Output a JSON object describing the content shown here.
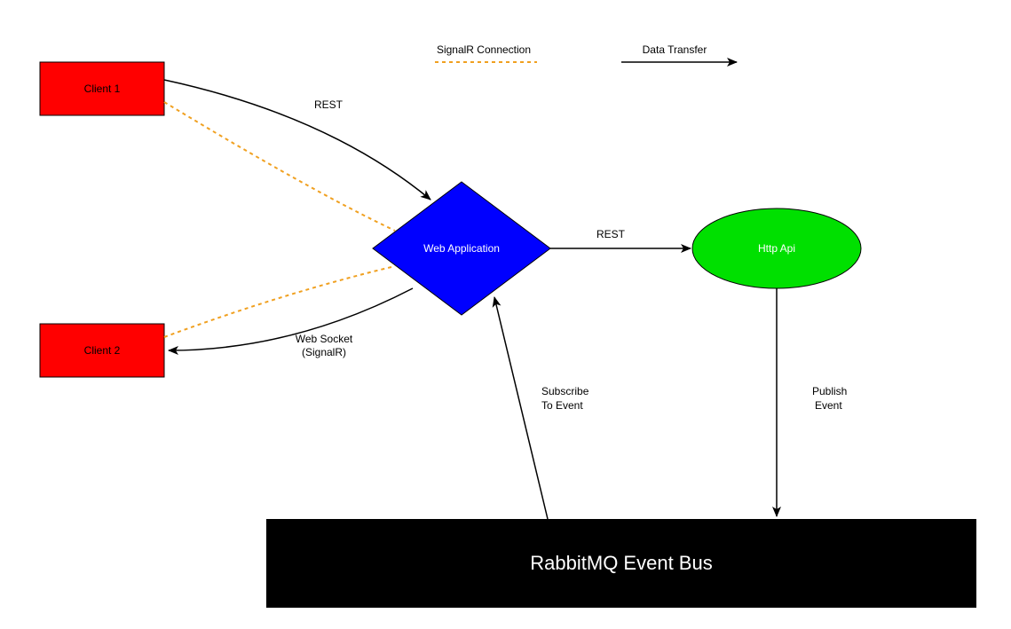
{
  "legend": {
    "signalr_label": "SignalR Connection",
    "data_transfer_label": "Data Transfer"
  },
  "nodes": {
    "client1": {
      "label": "Client 1",
      "fill": "#ff0000"
    },
    "client2": {
      "label": "Client 2",
      "fill": "#ff0000"
    },
    "webapp": {
      "label": "Web Application",
      "fill": "#0000ff"
    },
    "httpapi": {
      "label": "Http Api",
      "fill": "#00e000"
    },
    "bus": {
      "label": "RabbitMQ Event Bus",
      "fill": "#000000"
    }
  },
  "edges": {
    "client1_to_webapp": {
      "label": "REST"
    },
    "webapp_to_client2_line1": "Web Socket",
    "webapp_to_client2_line2": "(SignalR)",
    "webapp_to_httpapi": {
      "label": "REST"
    },
    "httpapi_to_bus_line1": "Publish",
    "httpapi_to_bus_line2": "Event",
    "bus_to_webapp_line1": "Subscribe",
    "bus_to_webapp_line2": "To Event"
  },
  "colors": {
    "signalr_line": "#f0a020",
    "arrow": "#000000"
  }
}
